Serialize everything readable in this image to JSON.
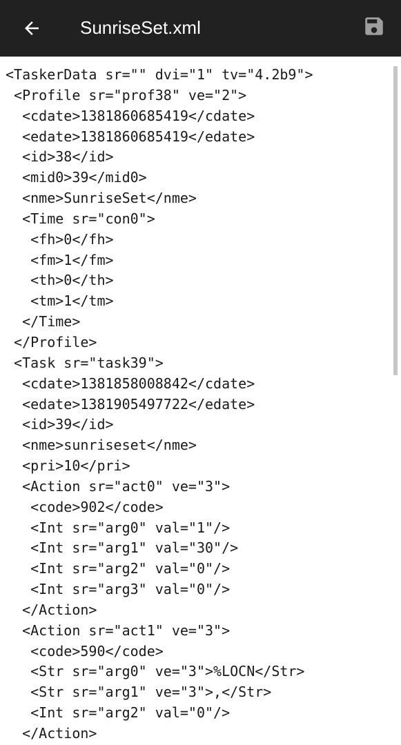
{
  "app_bar": {
    "title": "SunriseSet.xml",
    "back_icon": "arrow-back-icon",
    "save_icon": "save-icon"
  },
  "editor": {
    "lines": [
      "<TaskerData sr=\"\" dvi=\"1\" tv=\"4.2b9\">",
      " <Profile sr=\"prof38\" ve=\"2\">",
      "  <cdate>1381860685419</cdate>",
      "  <edate>1381860685419</edate>",
      "  <id>38</id>",
      "  <mid0>39</mid0>",
      "  <nme>SunriseSet</nme>",
      "  <Time sr=\"con0\">",
      "   <fh>0</fh>",
      "   <fm>1</fm>",
      "   <th>0</th>",
      "   <tm>1</tm>",
      "  </Time>",
      " </Profile>",
      " <Task sr=\"task39\">",
      "  <cdate>1381858008842</cdate>",
      "  <edate>1381905497722</edate>",
      "  <id>39</id>",
      "  <nme>sunriseset</nme>",
      "  <pri>10</pri>",
      "  <Action sr=\"act0\" ve=\"3\">",
      "   <code>902</code>",
      "   <Int sr=\"arg0\" val=\"1\"/>",
      "   <Int sr=\"arg1\" val=\"30\"/>",
      "   <Int sr=\"arg2\" val=\"0\"/>",
      "   <Int sr=\"arg3\" val=\"0\"/>",
      "  </Action>",
      "  <Action sr=\"act1\" ve=\"3\">",
      "   <code>590</code>",
      "   <Str sr=\"arg0\" ve=\"3\">%LOCN</Str>",
      "   <Str sr=\"arg1\" ve=\"3\">,</Str>",
      "   <Int sr=\"arg2\" val=\"0\"/>",
      "  </Action>"
    ]
  },
  "colors": {
    "app_bar_background": "#212121",
    "app_bar_foreground": "#ffffff",
    "save_icon_color": "#9e9e9e",
    "editor_background": "#ffffff",
    "editor_text": "#1a1a1a",
    "scrollbar": "#c6c6c6"
  }
}
